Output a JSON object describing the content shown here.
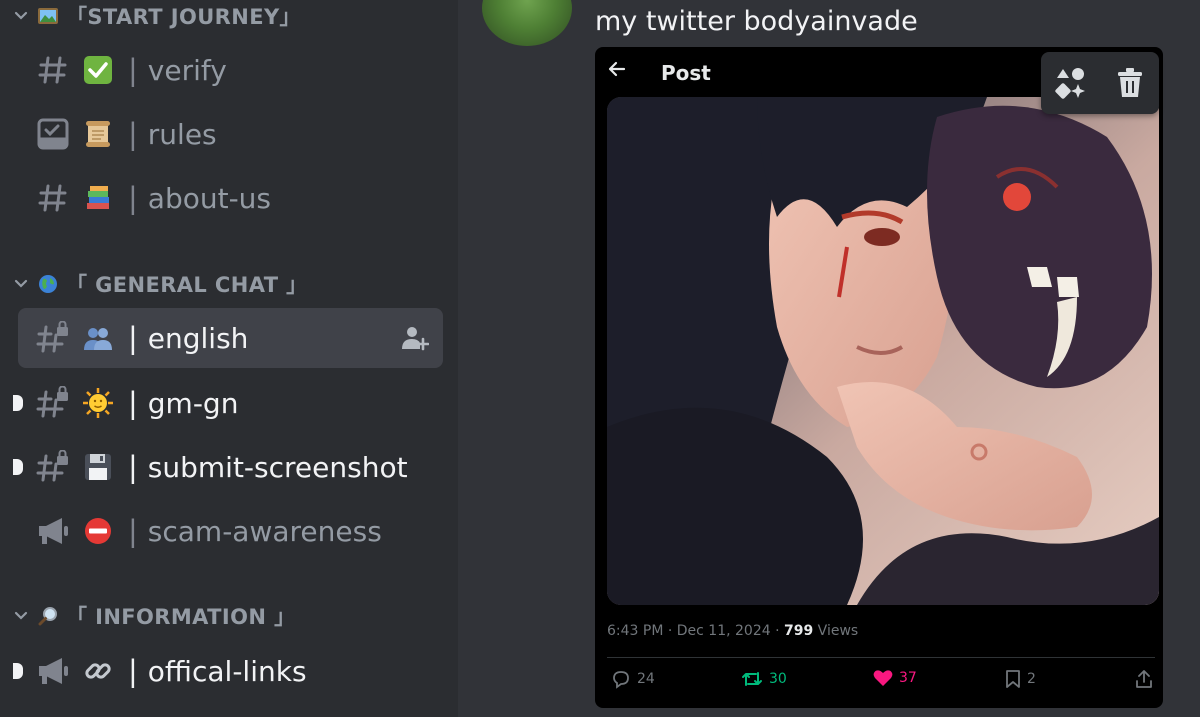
{
  "sidebar": {
    "categories": [
      {
        "name": "「START JOURNEY」",
        "icon": "framed-picture-emoji"
      },
      {
        "name": "「 GENERAL CHAT 」",
        "icon": "globe-emoji"
      },
      {
        "name": "「 INFORMATION 」",
        "icon": "magnifier-emoji"
      }
    ],
    "channels": [
      {
        "name": "verify",
        "emoji": "✅",
        "type": "text"
      },
      {
        "name": "rules",
        "emoji": "📜",
        "type": "rules"
      },
      {
        "name": "about-us",
        "emoji": "📚",
        "type": "text"
      },
      {
        "name": "english",
        "emoji": "👥",
        "type": "text-locked"
      },
      {
        "name": "gm-gn",
        "emoji": "🌞",
        "type": "text-locked"
      },
      {
        "name": "submit-screenshot",
        "emoji": "💾",
        "type": "text-locked"
      },
      {
        "name": "scam-awareness",
        "emoji": "⛔",
        "type": "announcement"
      },
      {
        "name": "offical-links",
        "emoji": "🔗",
        "type": "announcement"
      }
    ],
    "separator": "|"
  },
  "message": {
    "text": "my twitter bodyainvade"
  },
  "embed": {
    "header_title": "Post",
    "timestamp": "6:43 PM · Dec 11, 2024 · ",
    "views_count": "799",
    "views_label": " Views",
    "replies": "24",
    "reposts": "30",
    "likes": "37",
    "bookmarks": "2"
  },
  "colors": {
    "sidebar_bg": "#2b2d31",
    "chat_bg": "#313338",
    "selected_bg": "#404249",
    "repost_green": "#00ba7c",
    "like_pink": "#f91880"
  }
}
